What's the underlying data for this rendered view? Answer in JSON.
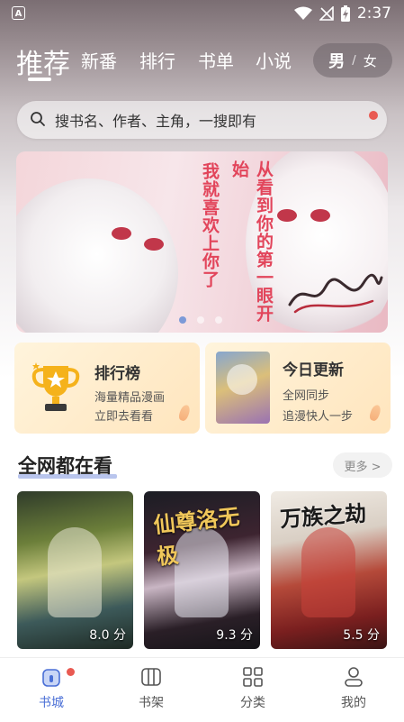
{
  "status_bar": {
    "time": "2:37",
    "app_icon_letter": "A"
  },
  "nav": {
    "tabs": [
      {
        "label": "推荐",
        "active": true
      },
      {
        "label": "新番"
      },
      {
        "label": "排行"
      },
      {
        "label": "书单"
      },
      {
        "label": "小说"
      }
    ],
    "gender": {
      "male": "男",
      "separator": "/",
      "female": "女"
    }
  },
  "search": {
    "placeholder": "搜书名、作者、主角，一搜即有"
  },
  "banner": {
    "line1": "从看到你的第一眼开始",
    "line2": "我就喜欢上你了",
    "page_count": 3,
    "active_page": 1
  },
  "quick_cards": [
    {
      "title": "排行榜",
      "line1": "海量精品漫画",
      "line2": "立即去看看"
    },
    {
      "title": "今日更新",
      "line1": "全网同步",
      "line2": "追漫快人一步"
    }
  ],
  "section": {
    "title": "全网都在看",
    "more": "更多 >"
  },
  "books": [
    {
      "cover_text": "",
      "score": "8.0 分"
    },
    {
      "cover_text": "仙尊洛无极",
      "score": "9.3 分"
    },
    {
      "cover_text": "万族之劫",
      "score": "5.5 分"
    }
  ],
  "bottom_tabs": [
    {
      "label": "书城",
      "active": true
    },
    {
      "label": "书架"
    },
    {
      "label": "分类"
    },
    {
      "label": "我的"
    }
  ],
  "colors": {
    "accent": "#4a6fd6",
    "badge": "#e95a52",
    "card_bg": "#ffe9c6"
  }
}
